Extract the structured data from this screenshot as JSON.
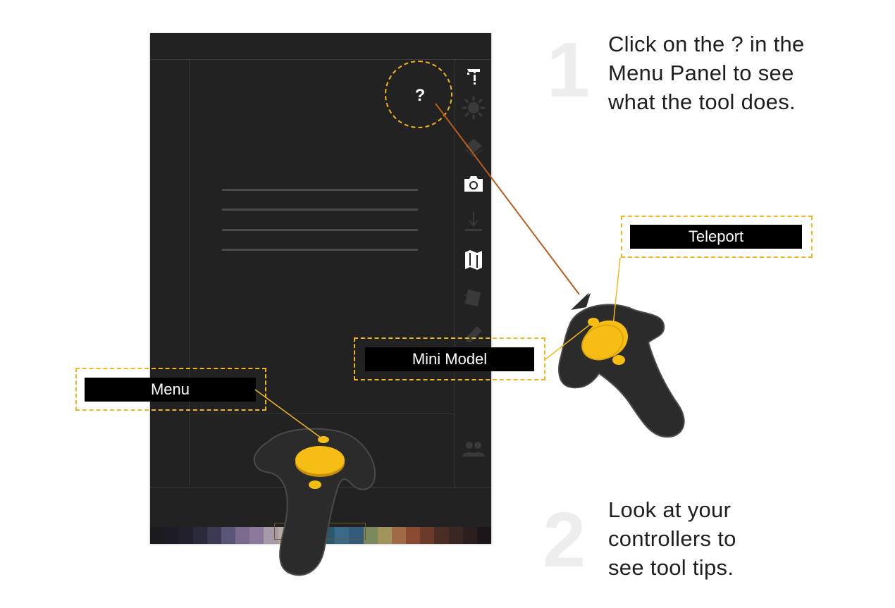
{
  "menu_panel": {
    "help_button": {
      "glyph": "?"
    },
    "side_icons": [
      {
        "icon": "tool-select-icon",
        "active": true
      },
      {
        "icon": "lighting-icon",
        "active": false
      },
      {
        "icon": "material-icon",
        "active": false
      },
      {
        "icon": "camera-icon",
        "active": true
      },
      {
        "icon": "import-icon",
        "active": false
      },
      {
        "icon": "map-icon",
        "active": true
      },
      {
        "icon": "layers-icon",
        "active": false
      },
      {
        "icon": "pencil-icon",
        "active": false
      },
      {
        "icon": "users-icon",
        "active": false
      }
    ],
    "palette_colors": [
      "#1a1a1f",
      "#1d1c24",
      "#22212b",
      "#2b2a3a",
      "#3b3a52",
      "#5a5577",
      "#7a6a8e",
      "#8c7898",
      "#a79aa8",
      "#b8aaa1",
      "#6e7a88",
      "#4a6a80",
      "#2a5a6e",
      "#3a6a88",
      "#335a7a",
      "#7a8a5e",
      "#a0945c",
      "#a06a46",
      "#8a4a32",
      "#6a3a2a",
      "#4a2e26",
      "#3a2622",
      "#2a1e1e",
      "#1c1618"
    ]
  },
  "tooltips": {
    "teleport": "Teleport",
    "mini_model": "Mini Model",
    "menu": "Menu"
  },
  "instructions": {
    "step1": {
      "number": "1",
      "lines": [
        "Click on the ? in the",
        "Menu Panel to see",
        "what the tool does."
      ]
    },
    "step2": {
      "number": "2",
      "lines": [
        "Look at your",
        "controllers to",
        "see tool tips."
      ]
    }
  },
  "colors": {
    "accent": "#f2b71f",
    "pointer": "#b85c1e",
    "controller_body": "#2b2b2b",
    "panel_bg": "#232222"
  }
}
